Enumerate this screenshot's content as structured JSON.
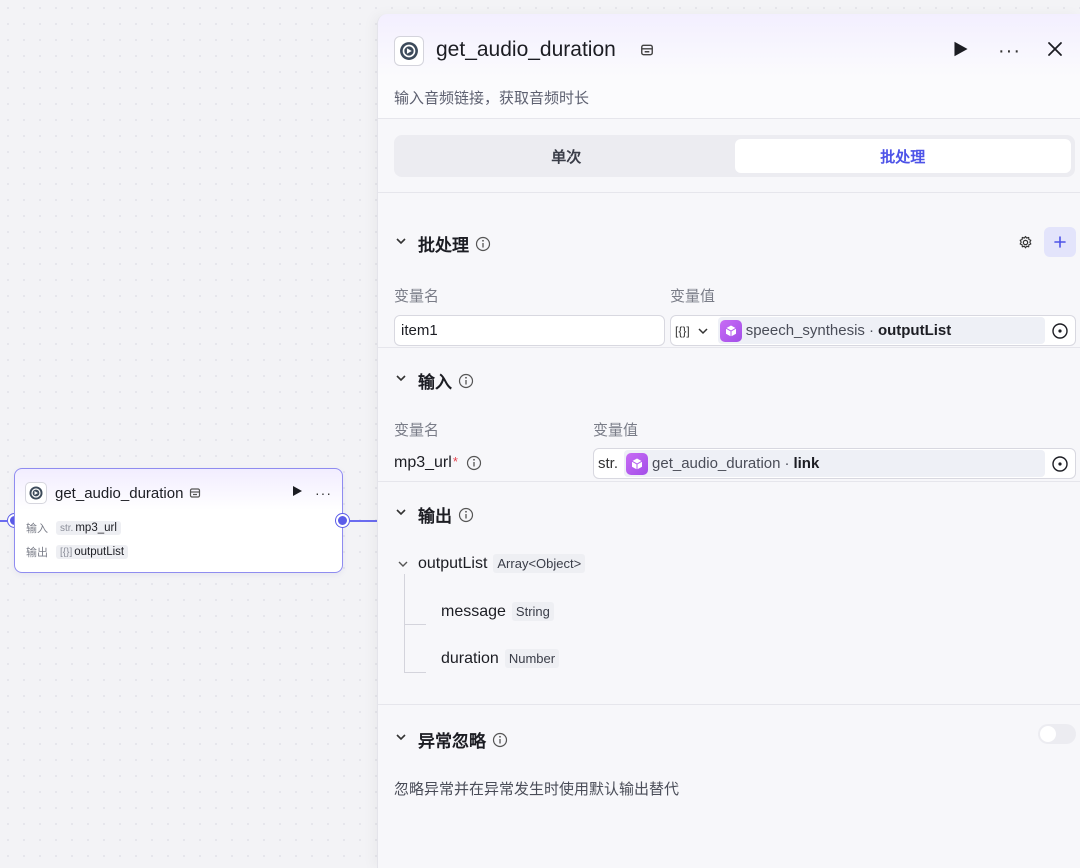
{
  "canvas_node": {
    "title": "get_audio_duration",
    "input_label": "输入",
    "input_prefix": "str.",
    "input_value": "mp3_url",
    "output_label": "输出",
    "output_prefix": "[{}]",
    "output_value": "outputList"
  },
  "panel": {
    "title": "get_audio_duration",
    "description": "输入音频链接，获取音频时长",
    "tabs": [
      {
        "label": "单次",
        "active": false
      },
      {
        "label": "批处理",
        "active": true
      }
    ],
    "batch": {
      "title": "批处理",
      "col_name": "变量名",
      "col_value": "变量值",
      "var_name": "item1",
      "type_prefix": "[{}]",
      "ref_source": "speech_synthesis",
      "ref_dot": "·",
      "ref_key": "outputList"
    },
    "input": {
      "title": "输入",
      "col_name": "变量名",
      "col_value": "变量值",
      "param_name": "mp3_url",
      "required_mark": "*",
      "type_prefix": "str.",
      "ref_source": "get_audio_duration",
      "ref_dot": "·",
      "ref_key": "link"
    },
    "output": {
      "title": "输出",
      "root": {
        "name": "outputList",
        "type": "Array<Object>"
      },
      "children": [
        {
          "name": "message",
          "type": "String"
        },
        {
          "name": "duration",
          "type": "Number"
        }
      ]
    },
    "exception": {
      "title": "异常忽略",
      "description": "忽略异常并在异常发生时使用默认输出替代",
      "enabled": false
    }
  },
  "colors": {
    "accent": "#4d53e8",
    "port": "#5b5ce8",
    "cube": "#b35cf0"
  }
}
